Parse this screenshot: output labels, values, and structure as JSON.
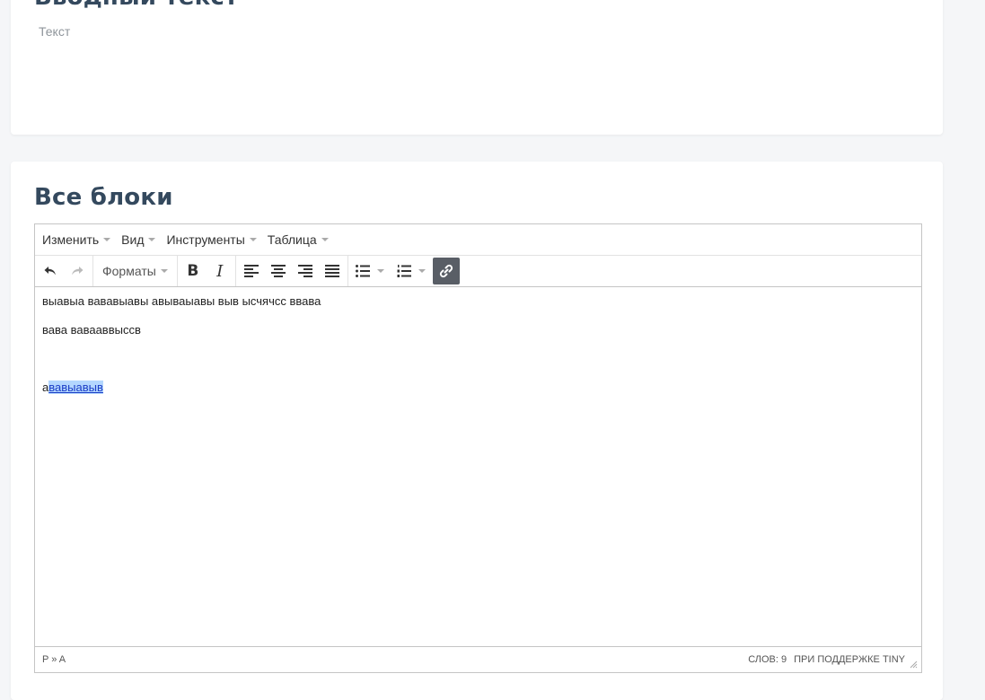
{
  "top_card": {
    "title": "Вводный текст",
    "placeholder": "Текст"
  },
  "main_card": {
    "title": "Все блоки"
  },
  "editor": {
    "menu": [
      {
        "label": "Изменить"
      },
      {
        "label": "Вид"
      },
      {
        "label": "Инструменты"
      },
      {
        "label": "Таблица"
      }
    ],
    "toolbar": {
      "formats_label": "Форматы",
      "bold_label": "B",
      "italic_label": "I",
      "icons": [
        "undo-icon",
        "redo-icon",
        "align-left-icon",
        "align-center-icon",
        "align-right-icon",
        "align-justify-icon",
        "bullet-list-icon",
        "numbered-list-icon",
        "link-icon"
      ]
    },
    "content": {
      "line1": "выавыа вававыавы авываыавы выв ысчячсс ввава",
      "line2": "вава вавааввыссв",
      "line3_plain": "а",
      "line3_link": "вавыавыв"
    },
    "status": {
      "path": "P » A",
      "word_count": "СЛОВ: 9",
      "powered_by": "ПРИ ПОДДЕРЖКЕ TINY"
    }
  },
  "colors": {
    "page_bg": "#f5f6f8",
    "title": "#34495e",
    "active_button": "#595e66",
    "link": "#1a3cc6",
    "selection": "#b4d7fe"
  }
}
